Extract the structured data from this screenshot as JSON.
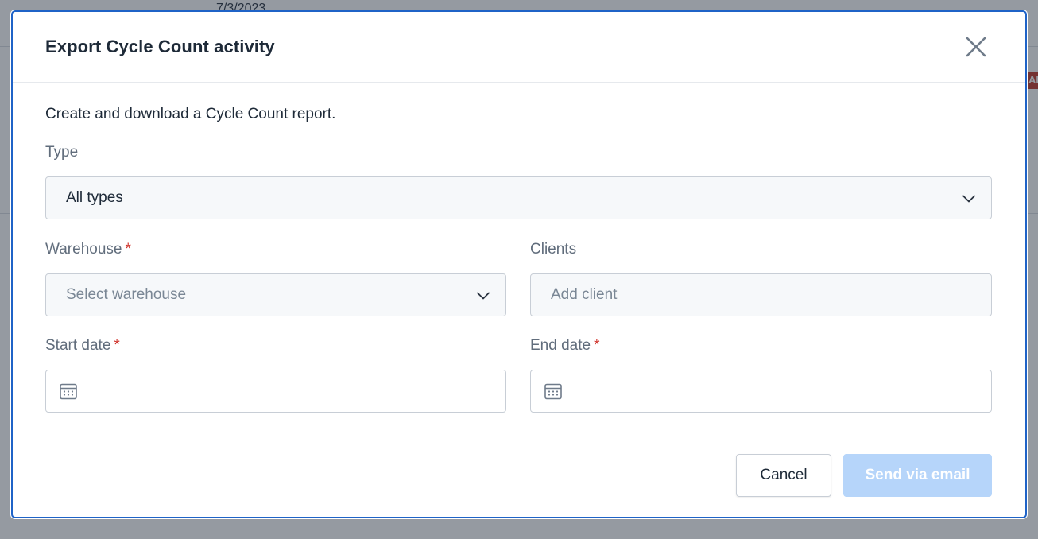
{
  "background": {
    "visible_date": "7/3/2023",
    "badge_text": "AI"
  },
  "modal": {
    "title": "Export Cycle Count activity",
    "close_icon": "close-icon",
    "description": "Create and download a Cycle Count report.",
    "type": {
      "label": "Type",
      "value": "All types"
    },
    "warehouse": {
      "label": "Warehouse",
      "required_mark": "*",
      "placeholder": "Select warehouse"
    },
    "clients": {
      "label": "Clients",
      "placeholder": "Add client"
    },
    "start_date": {
      "label": "Start date",
      "required_mark": "*",
      "icon": "calendar-icon"
    },
    "end_date": {
      "label": "End date",
      "required_mark": "*",
      "icon": "calendar-icon"
    },
    "footer": {
      "cancel_label": "Cancel",
      "send_label": "Send via email"
    }
  },
  "colors": {
    "primary_border": "#1f63c7",
    "send_button_disabled": "#b6d5fa",
    "required_mark": "#d0342c"
  }
}
